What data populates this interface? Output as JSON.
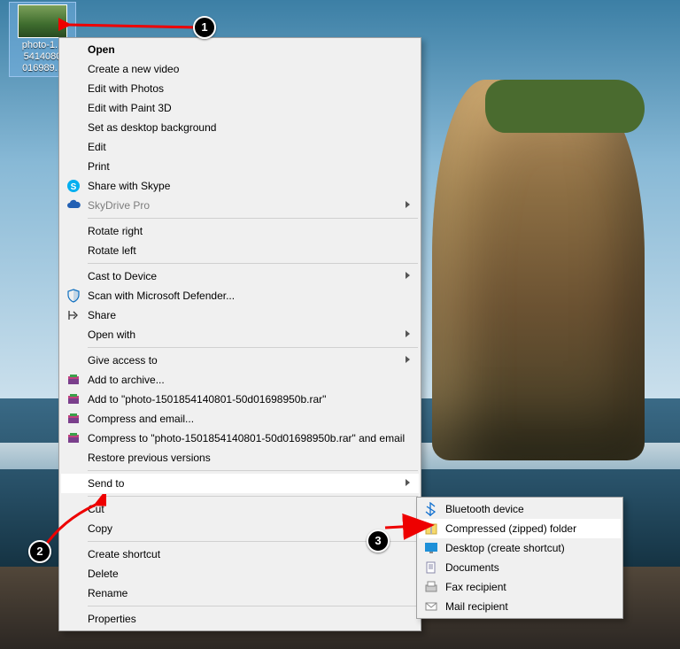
{
  "file": {
    "name": "photo-1501854140801-50d01698950b"
  },
  "file_display_lines": [
    "photo-1...",
    "5414080",
    "016989..."
  ],
  "menu": {
    "open": "Open",
    "create_video": "Create a new video",
    "edit_photos": "Edit with Photos",
    "edit_paint3d": "Edit with Paint 3D",
    "set_bg": "Set as desktop background",
    "edit": "Edit",
    "print": "Print",
    "skype": "Share with Skype",
    "skydrive": "SkyDrive Pro",
    "rotate_r": "Rotate right",
    "rotate_l": "Rotate left",
    "cast": "Cast to Device",
    "defender": "Scan with Microsoft Defender...",
    "share": "Share",
    "openwith": "Open with",
    "give_access": "Give access to",
    "rar_add": "Add to archive...",
    "rar_addto": "Add to \"photo-1501854140801-50d01698950b.rar\"",
    "rar_comp_email": "Compress and email...",
    "rar_compto_email": "Compress to \"photo-1501854140801-50d01698950b.rar\" and email",
    "restore": "Restore previous versions",
    "sendto": "Send to",
    "cut": "Cut",
    "copy": "Copy",
    "shortcut": "Create shortcut",
    "delete": "Delete",
    "rename": "Rename",
    "properties": "Properties"
  },
  "submenu": {
    "bluetooth": "Bluetooth device",
    "zip": "Compressed (zipped) folder",
    "desktop": "Desktop (create shortcut)",
    "documents": "Documents",
    "fax": "Fax recipient",
    "mail": "Mail recipient"
  },
  "annotations": {
    "a1": "1",
    "a2": "2",
    "a3": "3"
  }
}
